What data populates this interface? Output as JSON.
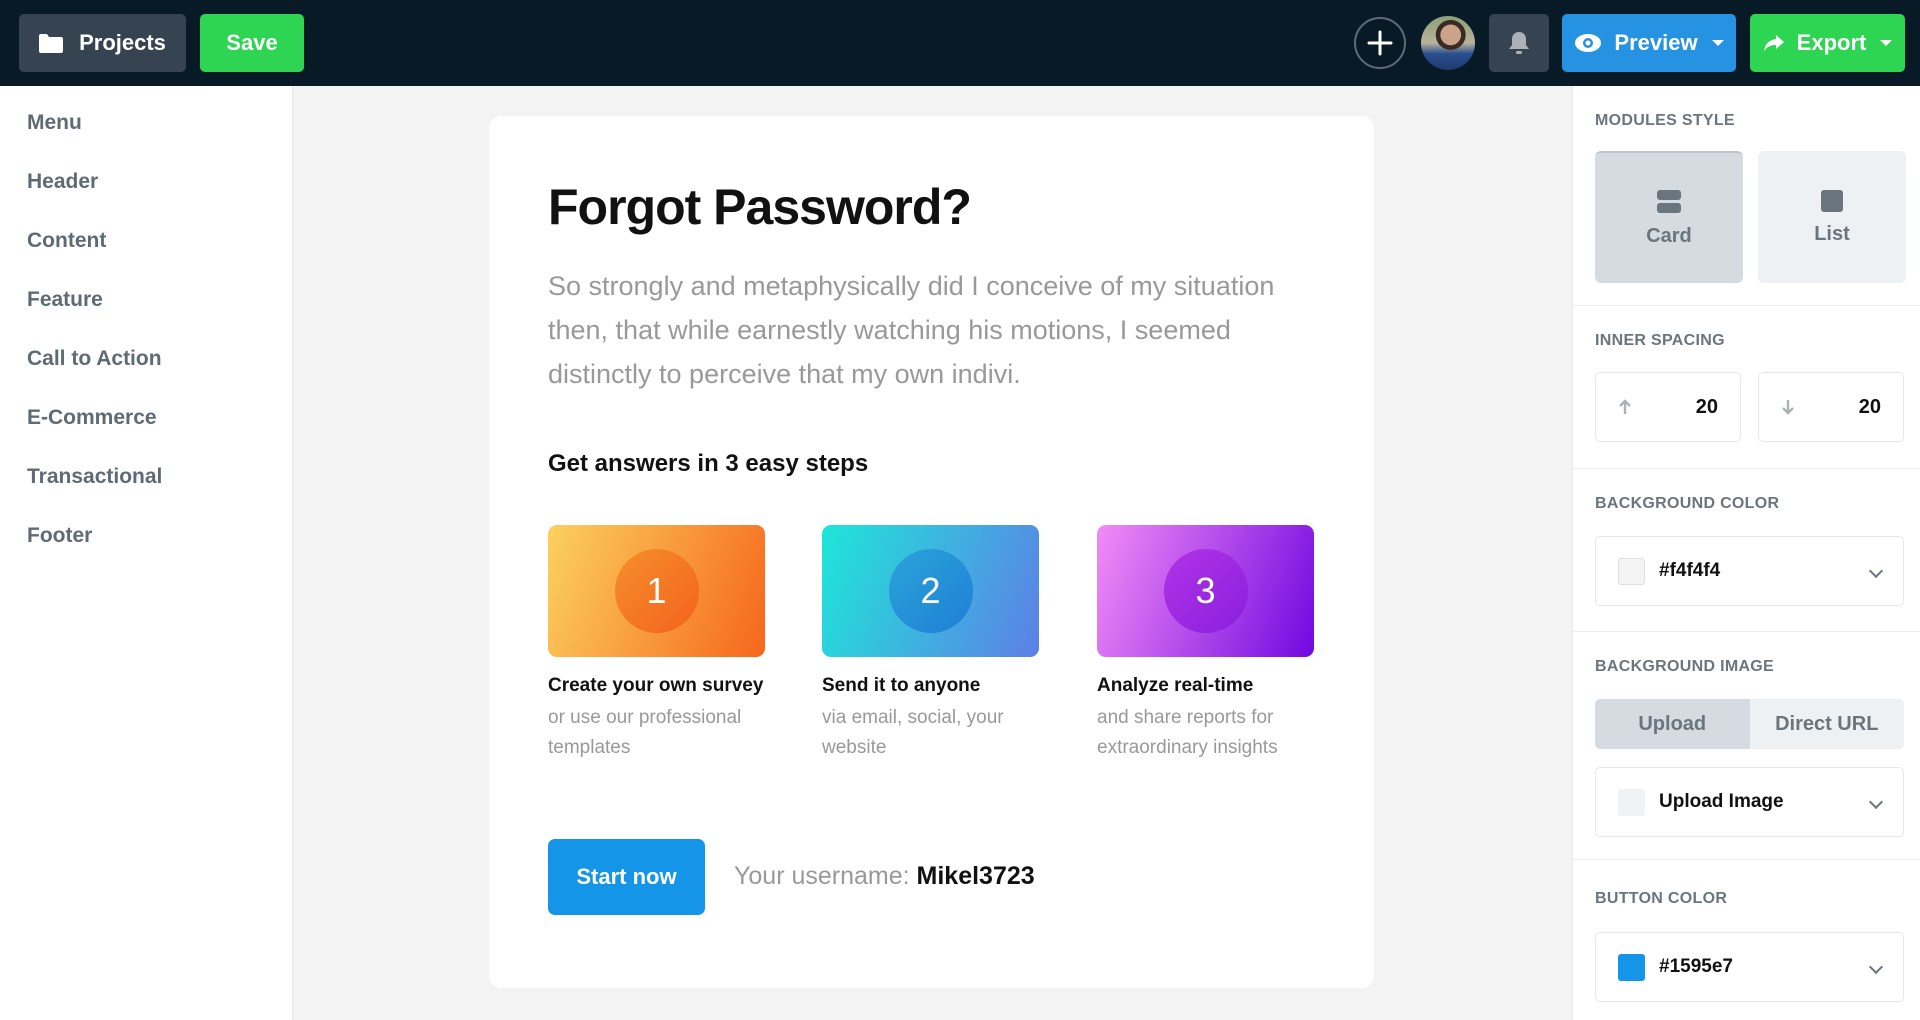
{
  "topbar": {
    "projects_label": "Projects",
    "save_label": "Save",
    "preview_label": "Preview",
    "export_label": "Export",
    "icons": {
      "projects": "folder-icon",
      "add": "plus-icon",
      "notifications": "bell-icon",
      "preview": "eye-icon",
      "export": "share-arrow-icon"
    }
  },
  "sidebar": {
    "items": [
      {
        "label": "Menu"
      },
      {
        "label": "Header"
      },
      {
        "label": "Content"
      },
      {
        "label": "Feature"
      },
      {
        "label": "Call to Action"
      },
      {
        "label": "E-Commerce"
      },
      {
        "label": "Transactional"
      },
      {
        "label": "Footer"
      }
    ]
  },
  "card": {
    "title": "Forgot Password?",
    "lead": "So strongly and metaphysically did I conceive of my situation then, that while earnestly watching his motions, I seemed distinctly to perceive that my own indivi.",
    "subtitle": "Get answers in 3 easy steps",
    "steps": [
      {
        "number": "1",
        "title": "Create your own survey",
        "desc": "or use our professional templates"
      },
      {
        "number": "2",
        "title": "Send it to anyone",
        "desc": "via email, social, your website"
      },
      {
        "number": "3",
        "title": "Analyze real-time",
        "desc": "and share reports for extraordinary insights"
      }
    ],
    "cta_label": "Start now",
    "username_label": "Your username:",
    "username_value": "Mikel3723"
  },
  "panel": {
    "modules_style": {
      "label": "MODULES STYLE",
      "options": [
        "Card",
        "List"
      ],
      "selected": "Card"
    },
    "inner_spacing": {
      "label": "INNER SPACING",
      "top": "20",
      "bottom": "20"
    },
    "background_color": {
      "label": "BACKGROUND COLOR",
      "value": "#f4f4f4"
    },
    "background_image": {
      "label": "BACKGROUND IMAGE",
      "tabs": [
        "Upload",
        "Direct URL"
      ],
      "selected": "Upload",
      "dropdown": "Upload Image"
    },
    "button_color": {
      "label": "BUTTON COLOR",
      "value": "#1595e7"
    }
  },
  "colors": {
    "topbar": "#081a26",
    "save": "#2ed553",
    "preview": "#2592e2",
    "accent": "#1595e7"
  }
}
